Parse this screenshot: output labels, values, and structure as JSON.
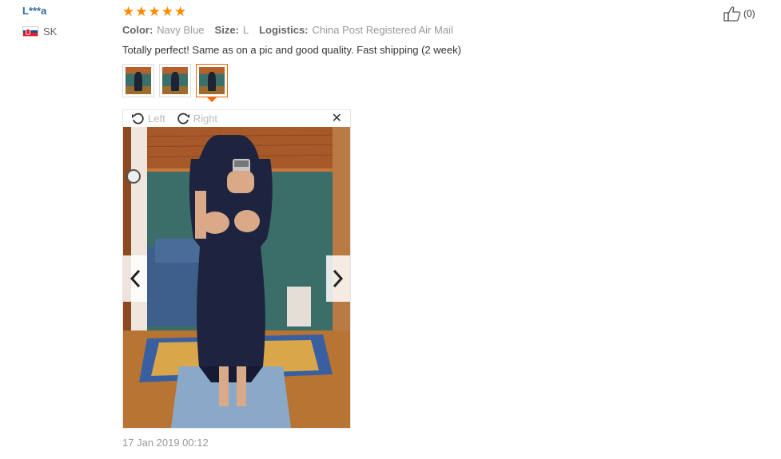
{
  "reviewer": {
    "name": "L***a",
    "country_code": "SK",
    "flag": "slovakia-flag"
  },
  "rating": {
    "stars": 5,
    "max": 5,
    "color": "#ff8a00"
  },
  "meta": {
    "color_label": "Color:",
    "color_value": "Navy Blue",
    "size_label": "Size:",
    "size_value": "L",
    "logistics_label": "Logistics:",
    "logistics_value": "China Post Registered Air Mail"
  },
  "review_text": "Totally perfect! Same as on a pic and good quality. Fast shipping (2 week)",
  "thumbnails": {
    "count": 3,
    "active_index": 2
  },
  "viewer": {
    "rotate_left_label": "Left",
    "rotate_right_label": "Right",
    "close_icon": "close-icon",
    "prev_icon": "chevron-left-icon",
    "next_icon": "chevron-right-icon"
  },
  "date": "17 Jan 2019 00:12",
  "helpful": {
    "icon": "thumbs-up-icon",
    "count_text": "(0)"
  },
  "colors": {
    "accent": "#ff6600",
    "link": "#2f6aa0",
    "muted": "#999999"
  }
}
